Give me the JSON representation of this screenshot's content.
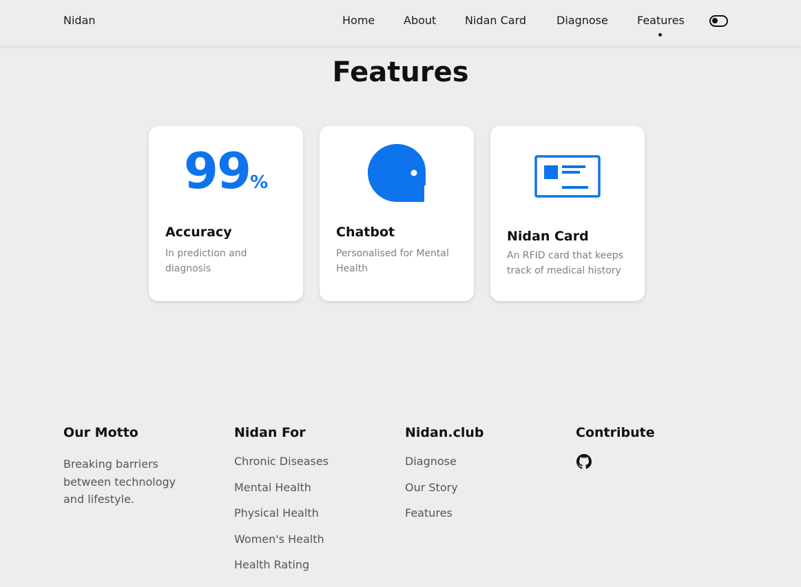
{
  "navbar": {
    "brand": "Nidan",
    "links": [
      "Home",
      "About",
      "Nidan Card",
      "Diagnose",
      "Features"
    ],
    "active_link": "Features",
    "theme_toggle_icon": "toggle-switch-icon"
  },
  "section": {
    "title": "Features"
  },
  "cards": [
    {
      "stat_value": "99",
      "stat_unit": "%",
      "title": "Accuracy",
      "description": "In prediction and diagnosis"
    },
    {
      "icon": "chatbot-head-icon",
      "title": "Chatbot",
      "description": "Personalised for Mental Health"
    },
    {
      "icon": "id-card-icon",
      "title": "Nidan Card",
      "description": "An RFID card that keeps track of medical history"
    }
  ],
  "footer": {
    "motto": {
      "title": "Our Motto",
      "text": "Breaking barriers between technology and lifestyle."
    },
    "nidan_for": {
      "title": "Nidan For",
      "links": [
        "Chronic Diseases",
        "Mental Health",
        "Physical Health",
        "Women's Health",
        "Health Rating"
      ]
    },
    "nidan_club": {
      "title": "Nidan.club",
      "links": [
        "Diagnose",
        "Our Story",
        "Features"
      ]
    },
    "contribute": {
      "title": "Contribute",
      "icon": "github-icon"
    }
  },
  "colors": {
    "accent": "#0d74ee",
    "background": "#ededed",
    "card": "#ffffff"
  }
}
